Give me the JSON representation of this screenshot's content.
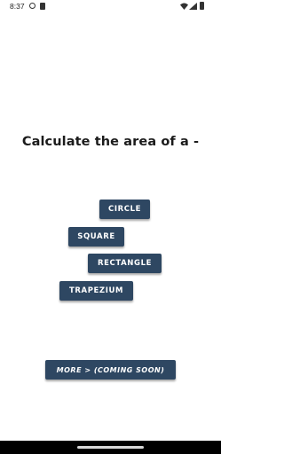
{
  "status_bar": {
    "time": "8:37",
    "icons": [
      "cc-circle-icon",
      "sd-card-icon",
      "wifi-icon",
      "signal-icon",
      "battery-icon"
    ]
  },
  "main": {
    "title": "Calculate the area of a -",
    "shapes": [
      {
        "label": "CIRCLE"
      },
      {
        "label": "SQUARE"
      },
      {
        "label": "RECTANGLE"
      },
      {
        "label": "TRAPEZIUM"
      }
    ],
    "more_label": "MORE > (COMING SOON)"
  },
  "colors": {
    "button_bg": "#2e4762",
    "button_text": "#ffffff",
    "title_text": "#1b1b1b",
    "background": "#ffffff"
  }
}
